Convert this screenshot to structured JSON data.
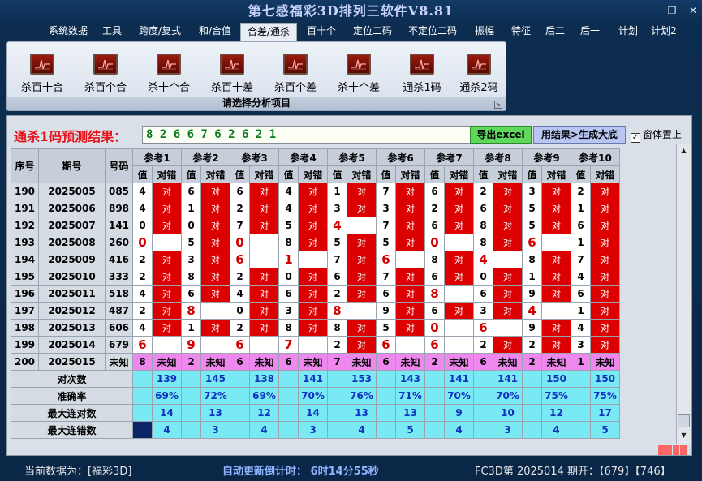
{
  "app": {
    "title": "第七感福彩3D排列三软件V8.81",
    "min": "—",
    "max": "❐",
    "close": "✕"
  },
  "menu": [
    "系统数据",
    "工具",
    "跨度/复式",
    "和/合值",
    "合差/通杀",
    "百十个",
    "定位二码",
    "不定位二码",
    "振幅",
    "特征",
    "后二",
    "后一",
    "计划",
    "计划2"
  ],
  "ribbon": {
    "buttons": [
      "杀百十合",
      "杀百个合",
      "杀十个合",
      "杀百十差",
      "杀百个差",
      "杀十个差",
      "通杀1码",
      "通杀2码"
    ],
    "caption": "请选择分析项目",
    "icon": "chart-icon"
  },
  "prediction": {
    "label": "通杀1码预测结果：",
    "value": "8 2 6 6 7 6 2 6 2 1",
    "export_btn": "导出excel",
    "result_btn": "用结果>生成大底",
    "topmost_label": "窗体置上",
    "topmost_checked": "✓"
  },
  "table": {
    "h_seq": "序号",
    "h_period": "期号",
    "h_num": "号码",
    "h_val": "值",
    "h_err": "对错",
    "refs": [
      "参考1",
      "参考2",
      "参考3",
      "参考4",
      "参考5",
      "参考6",
      "参考7",
      "参考8",
      "参考9",
      "参考10"
    ],
    "rows": [
      {
        "seq": "190",
        "period": "2025005",
        "num": "085",
        "cells": [
          [
            "4",
            "对"
          ],
          [
            "6",
            "对"
          ],
          [
            "6",
            "对"
          ],
          [
            "4",
            "对"
          ],
          [
            "1",
            "对"
          ],
          [
            "7",
            "对"
          ],
          [
            "6",
            "对"
          ],
          [
            "2",
            "对"
          ],
          [
            "3",
            "对"
          ],
          [
            "2",
            "对"
          ]
        ]
      },
      {
        "seq": "191",
        "period": "2025006",
        "num": "898",
        "cells": [
          [
            "4",
            "对"
          ],
          [
            "1",
            "对"
          ],
          [
            "2",
            "对"
          ],
          [
            "4",
            "对"
          ],
          [
            "3",
            "对"
          ],
          [
            "3",
            "对"
          ],
          [
            "2",
            "对"
          ],
          [
            "6",
            "对"
          ],
          [
            "5",
            "对"
          ],
          [
            "1",
            "对"
          ]
        ]
      },
      {
        "seq": "192",
        "period": "2025007",
        "num": "141",
        "cells": [
          [
            "0",
            "对"
          ],
          [
            "0",
            "对"
          ],
          [
            "7",
            "对"
          ],
          [
            "5",
            "对"
          ],
          [
            "4",
            ""
          ],
          [
            "7",
            "对"
          ],
          [
            "6",
            "对"
          ],
          [
            "8",
            "对"
          ],
          [
            "5",
            "对"
          ],
          [
            "6",
            "对"
          ]
        ]
      },
      {
        "seq": "193",
        "period": "2025008",
        "num": "260",
        "cells": [
          [
            "0",
            ""
          ],
          [
            "5",
            "对"
          ],
          [
            "0",
            ""
          ],
          [
            "8",
            "对"
          ],
          [
            "5",
            "对"
          ],
          [
            "5",
            "对"
          ],
          [
            "0",
            ""
          ],
          [
            "8",
            "对"
          ],
          [
            "6",
            ""
          ],
          [
            "1",
            "对"
          ]
        ]
      },
      {
        "seq": "194",
        "period": "2025009",
        "num": "416",
        "cells": [
          [
            "2",
            "对"
          ],
          [
            "3",
            "对"
          ],
          [
            "6",
            ""
          ],
          [
            "1",
            ""
          ],
          [
            "7",
            "对"
          ],
          [
            "6",
            ""
          ],
          [
            "8",
            "对"
          ],
          [
            "4",
            ""
          ],
          [
            "8",
            "对"
          ],
          [
            "7",
            "对"
          ]
        ]
      },
      {
        "seq": "195",
        "period": "2025010",
        "num": "333",
        "cells": [
          [
            "2",
            "对"
          ],
          [
            "8",
            "对"
          ],
          [
            "2",
            "对"
          ],
          [
            "0",
            "对"
          ],
          [
            "6",
            "对"
          ],
          [
            "7",
            "对"
          ],
          [
            "6",
            "对"
          ],
          [
            "0",
            "对"
          ],
          [
            "1",
            "对"
          ],
          [
            "4",
            "对"
          ]
        ]
      },
      {
        "seq": "196",
        "period": "2025011",
        "num": "518",
        "cells": [
          [
            "4",
            "对"
          ],
          [
            "6",
            "对"
          ],
          [
            "4",
            "对"
          ],
          [
            "6",
            "对"
          ],
          [
            "2",
            "对"
          ],
          [
            "6",
            "对"
          ],
          [
            "8",
            ""
          ],
          [
            "6",
            "对"
          ],
          [
            "9",
            "对"
          ],
          [
            "6",
            "对"
          ]
        ]
      },
      {
        "seq": "197",
        "period": "2025012",
        "num": "487",
        "cells": [
          [
            "2",
            "对"
          ],
          [
            "8",
            ""
          ],
          [
            "0",
            "对"
          ],
          [
            "3",
            "对"
          ],
          [
            "8",
            ""
          ],
          [
            "9",
            "对"
          ],
          [
            "6",
            "对"
          ],
          [
            "3",
            "对"
          ],
          [
            "4",
            ""
          ],
          [
            "1",
            "对"
          ]
        ]
      },
      {
        "seq": "198",
        "period": "2025013",
        "num": "606",
        "cells": [
          [
            "4",
            "对"
          ],
          [
            "1",
            "对"
          ],
          [
            "2",
            "对"
          ],
          [
            "8",
            "对"
          ],
          [
            "8",
            "对"
          ],
          [
            "5",
            "对"
          ],
          [
            "0",
            ""
          ],
          [
            "6",
            ""
          ],
          [
            "9",
            "对"
          ],
          [
            "4",
            "对"
          ]
        ]
      },
      {
        "seq": "199",
        "period": "2025014",
        "num": "679",
        "cells": [
          [
            "6",
            ""
          ],
          [
            "9",
            ""
          ],
          [
            "6",
            ""
          ],
          [
            "7",
            ""
          ],
          [
            "2",
            "对"
          ],
          [
            "6",
            ""
          ],
          [
            "6",
            ""
          ],
          [
            "2",
            "对"
          ],
          [
            "2",
            "对"
          ],
          [
            "3",
            "对"
          ]
        ]
      },
      {
        "seq": "200",
        "period": "2025015",
        "num": "未知",
        "cells": [
          [
            "8",
            "未知"
          ],
          [
            "2",
            "未知"
          ],
          [
            "6",
            "未知"
          ],
          [
            "6",
            "未知"
          ],
          [
            "7",
            "未知"
          ],
          [
            "6",
            "未知"
          ],
          [
            "2",
            "未知"
          ],
          [
            "6",
            "未知"
          ],
          [
            "2",
            "未知"
          ],
          [
            "1",
            "未知"
          ]
        ]
      }
    ],
    "stats": [
      {
        "label": "对次数",
        "values": [
          "139",
          "145",
          "138",
          "141",
          "153",
          "143",
          "141",
          "141",
          "150",
          "150"
        ]
      },
      {
        "label": "准确率",
        "values": [
          "69%",
          "72%",
          "69%",
          "70%",
          "76%",
          "71%",
          "70%",
          "70%",
          "75%",
          "75%"
        ]
      },
      {
        "label": "最大连对数",
        "values": [
          "14",
          "13",
          "12",
          "14",
          "13",
          "13",
          "9",
          "10",
          "12",
          "17"
        ]
      },
      {
        "label": "最大连错数",
        "values": [
          "4",
          "3",
          "4",
          "3",
          "4",
          "5",
          "4",
          "3",
          "4",
          "5"
        ]
      }
    ]
  },
  "status": {
    "source": "当前数据为：[福彩3D]",
    "countdown": "自动更新倒计时：  6时14分55秒",
    "draw": "FC3D第 2025014 期开：【679】【746】"
  },
  "colors": {
    "hit": "#dd0000",
    "unknown": "#ee88ee",
    "stats": "#79e9f3",
    "accent": "#e8111a"
  }
}
